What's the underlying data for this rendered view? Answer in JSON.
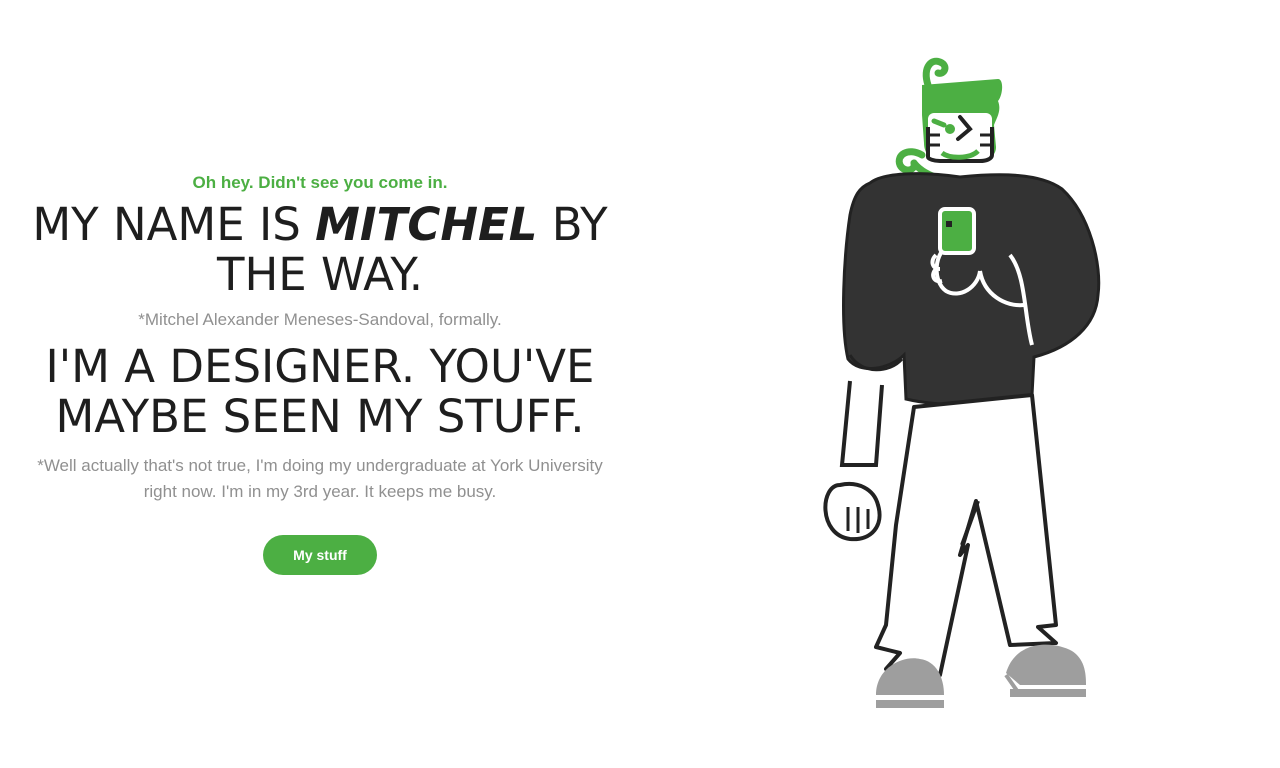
{
  "hero": {
    "greeting": "Oh hey. Didn't see you come in.",
    "headline_prefix": "MY NAME IS ",
    "headline_name": "MITCHEL",
    "headline_suffix": " BY THE WAY.",
    "formal_name_note": "*Mitchel Alexander Meneses-Sandoval, formally.",
    "designer_headline": "I'M A DESIGNER. YOU'VE MAYBE SEEN MY STUFF.",
    "undergrad_note": "*Well actually that's not true, I'm doing my undergraduate at York University right now. I'm in my 3rd year. It keeps me busy.",
    "cta_label": "My stuff"
  },
  "illustration": {
    "icon": "character-illustration",
    "colors": {
      "accent": "#4caf43",
      "sweater": "#333333",
      "outline": "#222222",
      "shoes": "#9e9e9e"
    }
  }
}
